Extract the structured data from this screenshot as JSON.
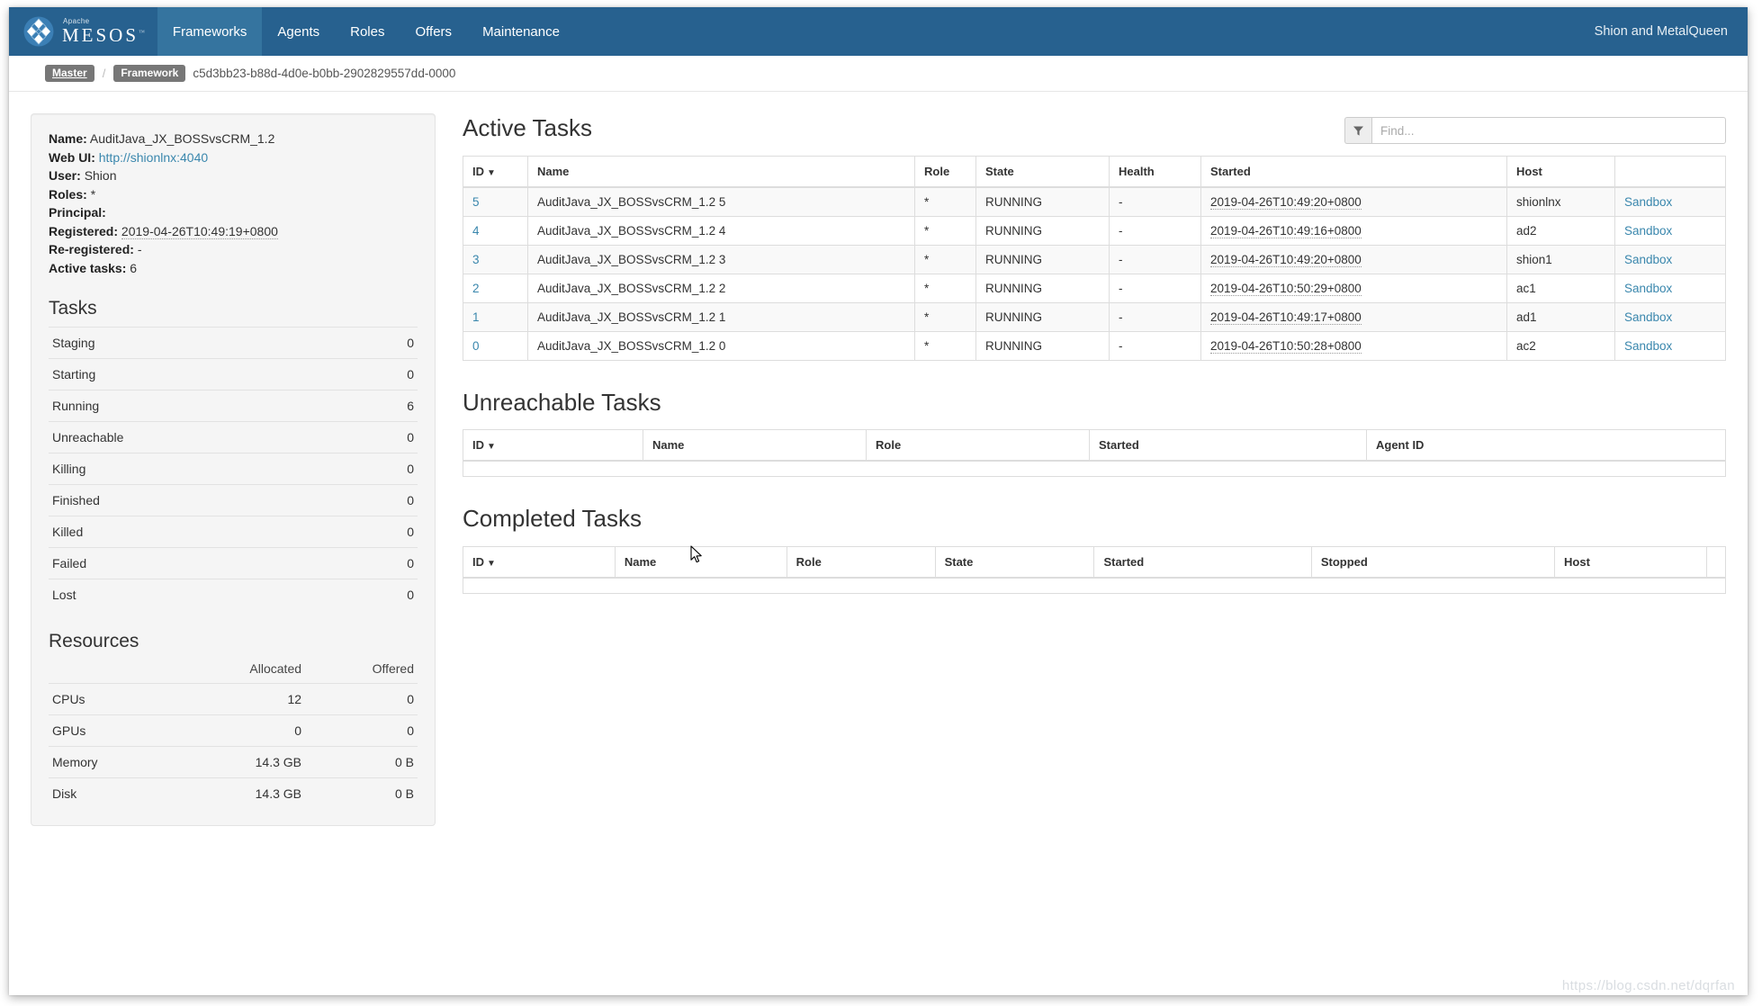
{
  "navbar": {
    "brand": {
      "apache": "Apache",
      "mesos": "MESOS",
      "tm": "™"
    },
    "items": [
      {
        "label": "Frameworks",
        "active": true
      },
      {
        "label": "Agents",
        "active": false
      },
      {
        "label": "Roles",
        "active": false
      },
      {
        "label": "Offers",
        "active": false
      },
      {
        "label": "Maintenance",
        "active": false
      }
    ],
    "right_text": "Shion and MetalQueen"
  },
  "breadcrumb": {
    "master_label": "Master",
    "separator": "/",
    "framework_label": "Framework",
    "framework_id": "c5d3bb23-b88d-4d0e-b0bb-2902829557dd-0000"
  },
  "sidebar": {
    "meta": [
      {
        "key": "Name:",
        "value": "AuditJava_JX_BOSSvsCRM_1.2",
        "type": "text"
      },
      {
        "key": "Web UI:",
        "value": "http://shionlnx:4040",
        "type": "link"
      },
      {
        "key": "User:",
        "value": "Shion",
        "type": "text"
      },
      {
        "key": "Roles:",
        "value": "*",
        "type": "text"
      },
      {
        "key": "Principal:",
        "value": "",
        "type": "text"
      },
      {
        "key": "Registered:",
        "value": "2019-04-26T10:49:19+0800",
        "type": "ts"
      },
      {
        "key": "Re-registered:",
        "value": "-",
        "type": "text"
      },
      {
        "key": "Active tasks:",
        "value": "6",
        "type": "text"
      }
    ],
    "tasks_title": "Tasks",
    "tasks": [
      {
        "label": "Staging",
        "count": "0"
      },
      {
        "label": "Starting",
        "count": "0"
      },
      {
        "label": "Running",
        "count": "6"
      },
      {
        "label": "Unreachable",
        "count": "0"
      },
      {
        "label": "Killing",
        "count": "0"
      },
      {
        "label": "Finished",
        "count": "0"
      },
      {
        "label": "Killed",
        "count": "0"
      },
      {
        "label": "Failed",
        "count": "0"
      },
      {
        "label": "Lost",
        "count": "0"
      }
    ],
    "resources_title": "Resources",
    "resources_headers": [
      "",
      "Allocated",
      "Offered"
    ],
    "resources": [
      {
        "label": "CPUs",
        "allocated": "12",
        "offered": "0"
      },
      {
        "label": "GPUs",
        "allocated": "0",
        "offered": "0"
      },
      {
        "label": "Memory",
        "allocated": "14.3 GB",
        "offered": "0 B"
      },
      {
        "label": "Disk",
        "allocated": "14.3 GB",
        "offered": "0 B"
      }
    ]
  },
  "main": {
    "find": {
      "placeholder": "Find...",
      "value": "",
      "icon": "filter-icon"
    },
    "active_tasks": {
      "title": "Active Tasks",
      "headers": [
        "ID",
        "Name",
        "Role",
        "State",
        "Health",
        "Started",
        "Host",
        ""
      ],
      "sort_caret": "▼",
      "sandbox_label": "Sandbox",
      "rows": [
        {
          "id": "5",
          "name": "AuditJava_JX_BOSSvsCRM_1.2 5",
          "role": "*",
          "state": "RUNNING",
          "health": "-",
          "started": "2019-04-26T10:49:20+0800",
          "host": "shionlnx"
        },
        {
          "id": "4",
          "name": "AuditJava_JX_BOSSvsCRM_1.2 4",
          "role": "*",
          "state": "RUNNING",
          "health": "-",
          "started": "2019-04-26T10:49:16+0800",
          "host": "ad2"
        },
        {
          "id": "3",
          "name": "AuditJava_JX_BOSSvsCRM_1.2 3",
          "role": "*",
          "state": "RUNNING",
          "health": "-",
          "started": "2019-04-26T10:49:20+0800",
          "host": "shion1"
        },
        {
          "id": "2",
          "name": "AuditJava_JX_BOSSvsCRM_1.2 2",
          "role": "*",
          "state": "RUNNING",
          "health": "-",
          "started": "2019-04-26T10:50:29+0800",
          "host": "ac1"
        },
        {
          "id": "1",
          "name": "AuditJava_JX_BOSSvsCRM_1.2 1",
          "role": "*",
          "state": "RUNNING",
          "health": "-",
          "started": "2019-04-26T10:49:17+0800",
          "host": "ad1"
        },
        {
          "id": "0",
          "name": "AuditJava_JX_BOSSvsCRM_1.2 0",
          "role": "*",
          "state": "RUNNING",
          "health": "-",
          "started": "2019-04-26T10:50:28+0800",
          "host": "ac2"
        }
      ]
    },
    "unreachable_tasks": {
      "title": "Unreachable Tasks",
      "headers": [
        "ID",
        "Name",
        "Role",
        "Started",
        "Agent ID"
      ],
      "sort_caret": "▼",
      "rows": []
    },
    "completed_tasks": {
      "title": "Completed Tasks",
      "headers": [
        "ID",
        "Name",
        "Role",
        "State",
        "Started",
        "Stopped",
        "Host",
        ""
      ],
      "sort_caret": "▼",
      "rows": []
    }
  },
  "watermark": "https://blog.csdn.net/dqrfan"
}
